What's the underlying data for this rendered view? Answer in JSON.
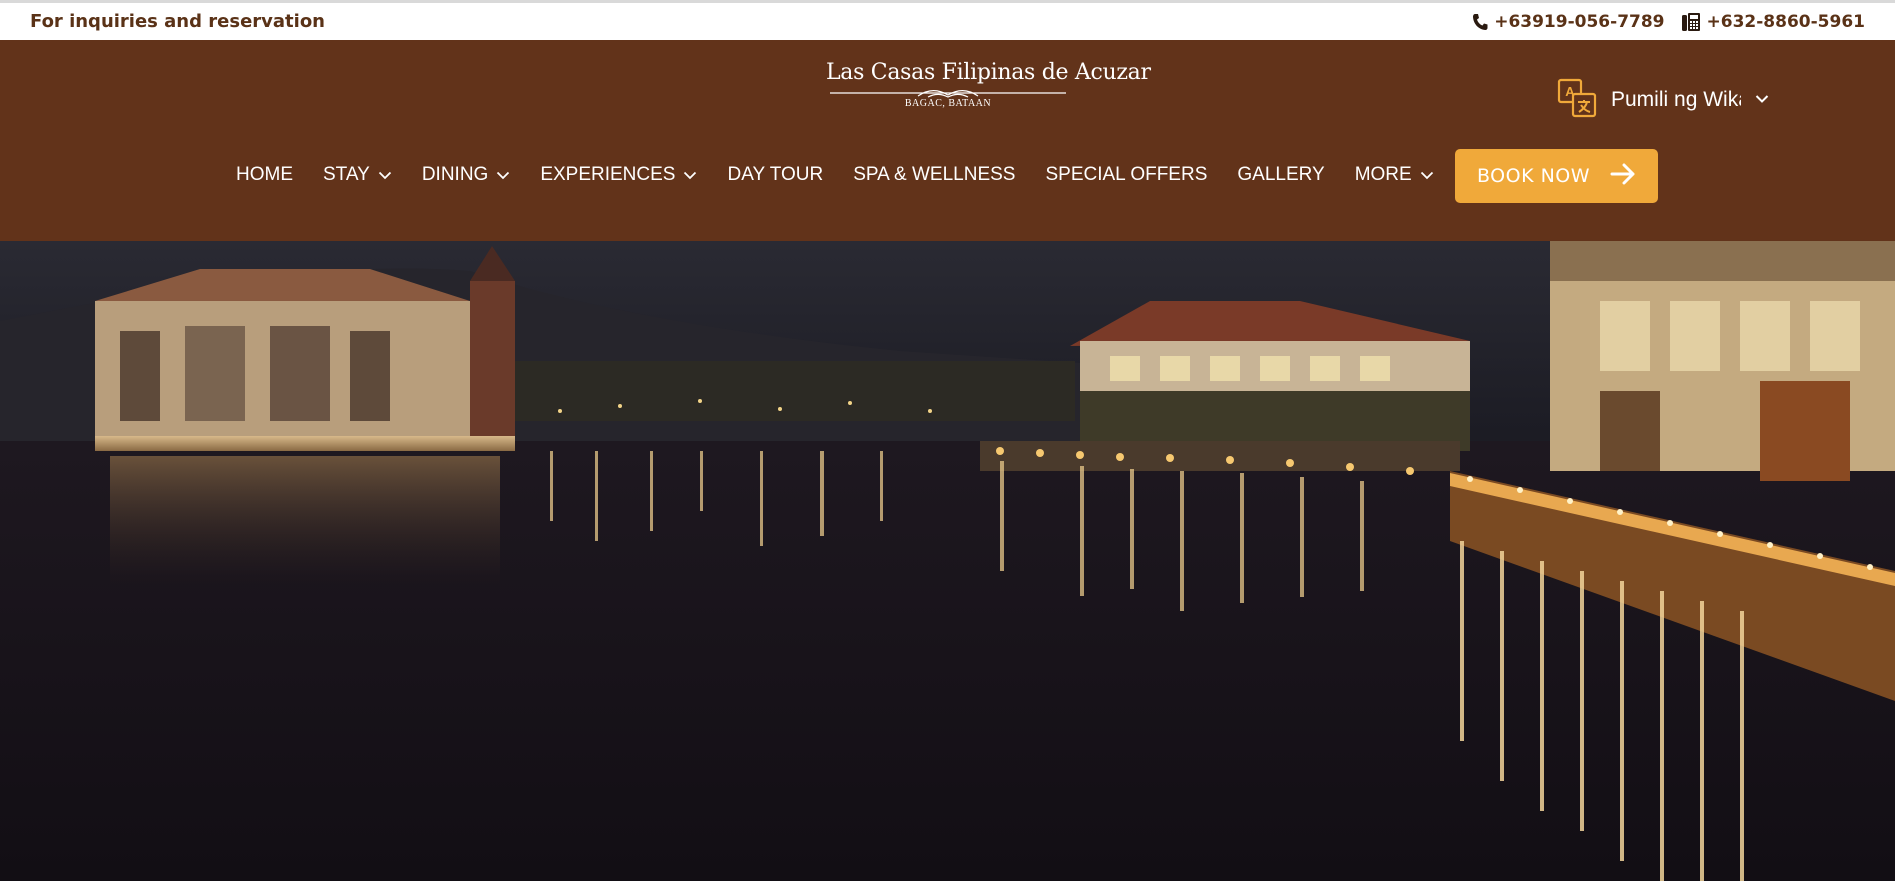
{
  "topbar": {
    "inquiry_text": "For inquiries and reservation",
    "mobile_icon": "phone-icon",
    "mobile": "+63919-056-7789",
    "landline_icon": "desk-phone-icon",
    "landline": "+632-8860-5961"
  },
  "header": {
    "logo": {
      "name": "Las Casas Filipinas de Acuzar",
      "location": "BAGAC, BATAAN"
    },
    "language": {
      "icon": "translate-icon",
      "label": "Pumili ng Wika",
      "chevron_icon": "chevron-down-icon"
    },
    "nav": [
      {
        "label": "HOME",
        "dropdown": false
      },
      {
        "label": "STAY",
        "dropdown": true
      },
      {
        "label": "DINING",
        "dropdown": true
      },
      {
        "label": "EXPERIENCES",
        "dropdown": true
      },
      {
        "label": "DAY TOUR",
        "dropdown": false
      },
      {
        "label": "SPA & WELLNESS",
        "dropdown": false
      },
      {
        "label": "SPECIAL OFFERS",
        "dropdown": false
      },
      {
        "label": "GALLERY",
        "dropdown": false
      },
      {
        "label": "MORE",
        "dropdown": true
      }
    ],
    "book_button": {
      "label": "BOOK NOW",
      "icon": "arrow-right-icon"
    }
  },
  "colors": {
    "header_bg": "#62331a",
    "accent": "#f0a93a",
    "topbar_text": "#5a3217",
    "white": "#ffffff"
  },
  "hero": {
    "image": "night view of heritage resort buildings reflected on river"
  }
}
